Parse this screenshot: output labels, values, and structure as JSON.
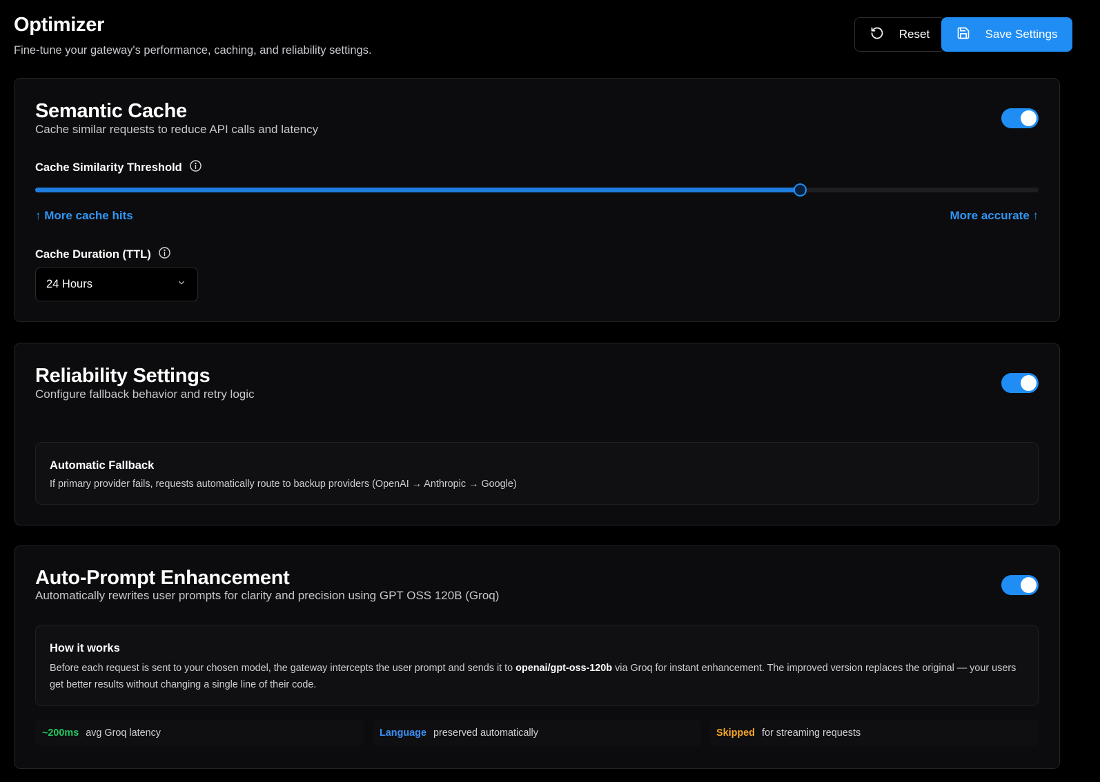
{
  "header": {
    "title": "Optimizer",
    "subtitle": "Fine-tune your gateway's performance, caching, and reliability settings.",
    "reset_label": "Reset",
    "save_label": "Save Settings"
  },
  "semantic_cache": {
    "title": "Semantic Cache",
    "description": "Cache similar requests to reduce API calls and latency",
    "enabled": true,
    "threshold_label": "Cache Similarity Threshold",
    "threshold_position": 0.762,
    "hint_left": "↑ More cache hits",
    "hint_right": "More accurate ↑",
    "ttl_label": "Cache Duration (TTL)",
    "ttl_value": "24 Hours"
  },
  "reliability": {
    "title": "Reliability Settings",
    "description": "Configure fallback behavior and retry logic",
    "enabled": true,
    "fallback_title": "Automatic Fallback",
    "fallback_text": "If primary provider fails, requests automatically route to backup providers (OpenAI → Anthropic → Google)"
  },
  "auto_prompt": {
    "title": "Auto-Prompt Enhancement",
    "description": "Automatically rewrites user prompts for clarity and precision using GPT OSS 120B (Groq)",
    "enabled": true,
    "how_title": "How it works",
    "how_text_before": "Before each request is sent to your chosen model, the gateway intercepts the user prompt and sends it to ",
    "how_model": "openai/gpt-oss-120b",
    "how_text_after": " via Groq for instant enhancement. The improved version replaces the original — your users get better results without changing a single line of their code.",
    "stats": [
      {
        "highlight": "~200ms",
        "text": "avg Groq latency",
        "color": "#22c55e"
      },
      {
        "highlight": "Language",
        "text": "preserved automatically",
        "color": "#3b8ff5"
      },
      {
        "highlight": "Skipped",
        "text": "for streaming requests",
        "color": "#f5a524"
      }
    ]
  },
  "colors": {
    "accent": "#1f8df4",
    "background": "#000000",
    "card": "#0c0c0e"
  }
}
